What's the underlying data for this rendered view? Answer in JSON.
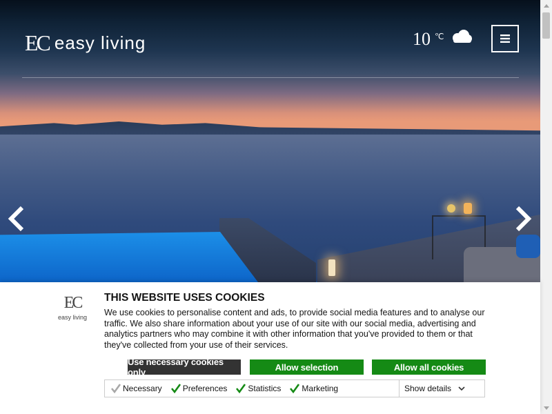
{
  "brand": {
    "mark": "EC",
    "name": "easy living"
  },
  "weather": {
    "temperature": "10",
    "unit": "℃",
    "icon": "cloud-icon"
  },
  "cookie": {
    "title": "THIS WEBSITE USES COOKIES",
    "body": "We use cookies to personalise content and ads, to provide social media features and to analyse our traffic. We also share information about your use of our site with our social media, advertising and analytics partners who may combine it with other information that you've provided to them or that they've collected from your use of their services.",
    "logo_mark": "EC",
    "logo_text": "easy living",
    "buttons": {
      "necessary": "Use necessary cookies only",
      "selection": "Allow selection",
      "all": "Allow all cookies"
    },
    "checkboxes": [
      {
        "label": "Necessary",
        "checked": true,
        "disabled": true
      },
      {
        "label": "Preferences",
        "checked": true
      },
      {
        "label": "Statistics",
        "checked": true
      },
      {
        "label": "Marketing",
        "checked": true
      }
    ],
    "show_details": "Show details"
  },
  "colors": {
    "accent_green": "#158a15",
    "dark_button": "#333333"
  }
}
